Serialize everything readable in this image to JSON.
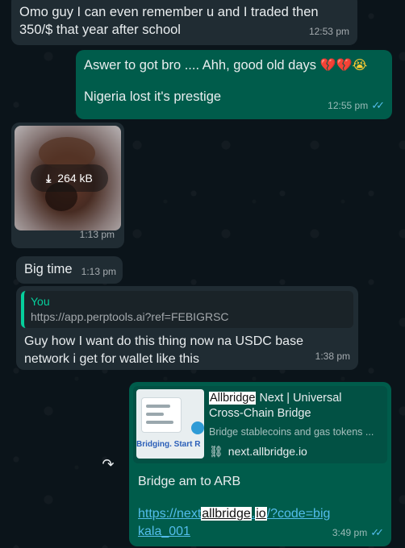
{
  "messages": {
    "m1": {
      "text_line1": "Omo guy I can even remember u and I traded then",
      "text_line2": "350/$ that year after school",
      "time": "12:53 pm"
    },
    "m2": {
      "line1": "Aswer to got bro .... Ahh, good old days",
      "line2": "Nigeria lost it's prestige",
      "time": "12:55 pm",
      "ticks": "✓✓",
      "emoji": [
        "💔",
        "💔",
        "😭"
      ]
    },
    "m3": {
      "size": "264 kB",
      "download_icon": "download-icon",
      "time": "1:13 pm"
    },
    "m4": {
      "text": "Big time",
      "time": "1:13 pm"
    },
    "m5": {
      "quote_author": "You",
      "quote_text": "https://app.perptools.ai?ref=FEBIGRSC",
      "text_line1": "Guy how I want do this thing now na USDC base",
      "text_line2": "network i get for wallet like this",
      "time": "1:38 pm"
    },
    "m6": {
      "preview_title_hl": "Allbridge",
      "preview_title_rest": " Next | Universal",
      "preview_title_line2": "Cross-Chain Bridge",
      "preview_desc": "Bridge stablecoins and gas tokens ...",
      "preview_domain": "next.allbridge.io",
      "thumb_caption": "Bridging. Start R",
      "text": "Bridge am to ARB",
      "link_part1": "https://next",
      "link_hl1": "allbridge",
      "link_part2": ".",
      "link_hl2": "io",
      "link_part3": "/?code=bigkala_001",
      "time": "3:49 pm",
      "ticks": "✓✓"
    }
  },
  "colors": {
    "incoming": "#202c33",
    "outgoing": "#005c4b",
    "accent": "#06cf9c",
    "link": "#53bdeb",
    "background": "#0b141a"
  }
}
